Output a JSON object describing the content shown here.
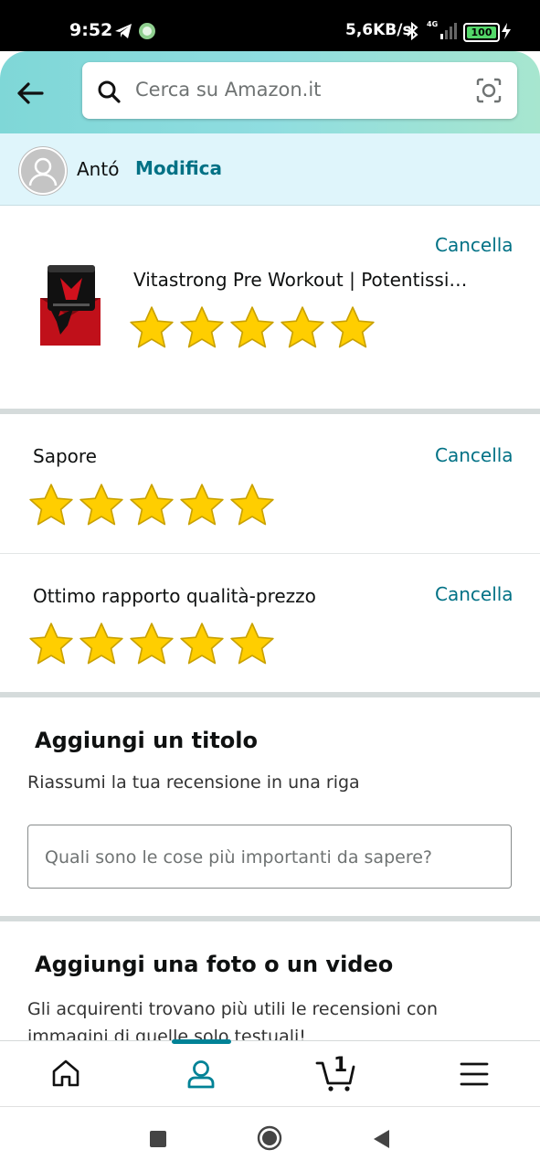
{
  "status_bar": {
    "time": "9:52",
    "network_speed": "5,6KB/s",
    "signal_label": "4G",
    "battery": "100"
  },
  "header": {
    "search_placeholder": "Cerca su Amazon.it"
  },
  "profile": {
    "name": "Antó",
    "edit_label": "Modifica"
  },
  "product": {
    "title": "Vitastrong Pre Workout | Potentissi…",
    "rating": 5,
    "cancel_label": "Cancella"
  },
  "attributes": [
    {
      "label": "Sapore",
      "rating": 5,
      "cancel_label": "Cancella"
    },
    {
      "label": "Ottimo rapporto qualità-prezzo",
      "rating": 5,
      "cancel_label": "Cancella"
    }
  ],
  "title_section": {
    "heading": "Aggiungi un titolo",
    "subtitle": "Riassumi la tua recensione in una riga",
    "input_placeholder": "Quali sono le cose più importanti da sapere?"
  },
  "media_section": {
    "heading": "Aggiungi una foto o un video",
    "text": "Gli acquirenti trovano più utili le recensioni con immagini di quelle solo testuali!"
  },
  "bottom_nav": {
    "cart_count": "1",
    "active": "profile"
  },
  "colors": {
    "link": "#007185",
    "star": "#ffce00",
    "star_stroke": "#c9a100",
    "header_gradient_start": "#7fd7d7",
    "header_gradient_end": "#a7e6cf",
    "profile_bg": "#dff5fb"
  }
}
